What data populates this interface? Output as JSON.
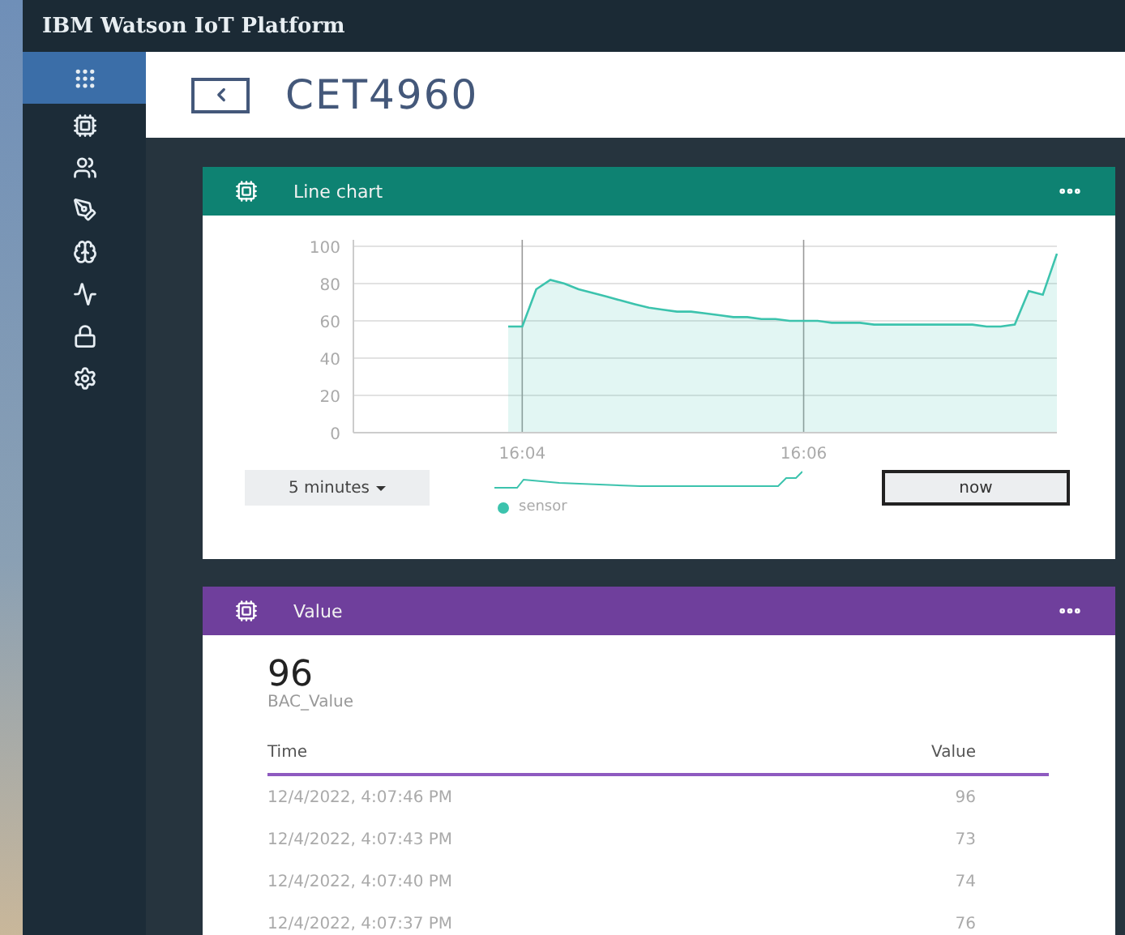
{
  "app": {
    "title": "IBM Watson IoT Platform"
  },
  "sidebar": {
    "items": [
      {
        "selected": true
      },
      {
        "selected": false
      },
      {
        "selected": false
      },
      {
        "selected": false
      },
      {
        "selected": false
      },
      {
        "selected": false
      },
      {
        "selected": false
      },
      {
        "selected": false
      }
    ]
  },
  "page": {
    "title": "CET4960"
  },
  "line_card": {
    "title": "Line chart",
    "color": "#0e8272",
    "chart_data": {
      "type": "area",
      "categories": [
        null,
        null,
        null,
        null,
        null,
        null,
        null,
        null,
        null,
        null,
        null,
        null,
        "16:04",
        null,
        null,
        null,
        null,
        null,
        null,
        null,
        null,
        null,
        null,
        null,
        null,
        null,
        null,
        null,
        null,
        null,
        null,
        null,
        "16:06",
        null,
        null,
        null,
        null,
        null,
        null,
        null,
        null,
        null,
        null,
        null,
        null,
        null,
        null,
        null,
        null,
        null,
        null
      ],
      "series": [
        {
          "name": "sensor",
          "color": "#3cc3ad",
          "values": [
            null,
            null,
            null,
            null,
            null,
            null,
            null,
            null,
            null,
            null,
            null,
            57,
            57,
            77,
            82,
            80,
            77,
            75,
            73,
            71,
            69,
            67,
            66,
            65,
            65,
            64,
            63,
            62,
            62,
            61,
            61,
            60,
            60,
            60,
            59,
            59,
            59,
            58,
            58,
            58,
            58,
            58,
            58,
            58,
            58,
            57,
            57,
            58,
            76,
            74,
            96
          ]
        }
      ],
      "ylim": [
        0,
        100
      ],
      "yticks": [
        0,
        20,
        40,
        60,
        80,
        100
      ],
      "grid": true
    },
    "range": "5 minutes",
    "now_button": "now"
  },
  "value_card": {
    "title": "Value",
    "color": "#6f3f9c",
    "value": "96",
    "label": "BAC_Value",
    "columns": [
      "Time",
      "Value"
    ],
    "rows": [
      [
        "12/4/2022, 4:07:46 PM",
        "96"
      ],
      [
        "12/4/2022, 4:07:43 PM",
        "73"
      ],
      [
        "12/4/2022, 4:07:40 PM",
        "74"
      ],
      [
        "12/4/2022, 4:07:37 PM",
        "76"
      ]
    ]
  }
}
